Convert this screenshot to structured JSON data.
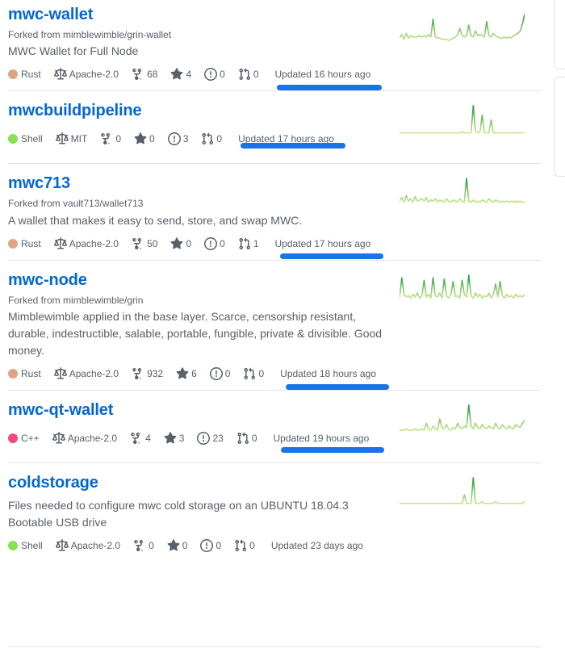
{
  "colors": {
    "link_blue": "#0366d6",
    "muted_text": "#586069",
    "border": "#e1e4e8",
    "highlight_blue": "#1a73e8",
    "spark_light": "#c6e48b",
    "spark_dark": "#239a3b"
  },
  "icons": {
    "law": "law-icon",
    "fork": "repo-forked-icon",
    "star": "star-icon",
    "issue": "issue-opened-icon",
    "pull": "git-pull-request-icon",
    "lang_dot": "language-color-dot-icon"
  },
  "languages": {
    "Rust": "#dea584",
    "Shell": "#89e051",
    "C++": "#f34b7d"
  },
  "repos": [
    {
      "name": "mwc-wallet",
      "forked_from": "Forked from mimblewimble/grin-wallet",
      "description": "MWC Wallet for Full Node",
      "language": "Rust",
      "license": "Apache-2.0",
      "forks": "68",
      "stars": "4",
      "issues": "0",
      "pulls": "0",
      "updated": "Updated 16 hours ago",
      "highlighted": true,
      "sparkline": [
        6,
        9,
        5,
        10,
        6,
        8,
        7,
        7,
        7,
        8,
        7,
        8,
        7,
        9,
        7,
        22,
        7,
        6,
        6,
        5,
        5,
        5,
        4,
        5,
        6,
        7,
        9,
        14,
        8,
        7,
        8,
        17,
        8,
        7,
        12,
        8,
        9,
        8,
        7,
        20,
        8,
        7,
        10,
        8,
        7,
        6,
        6,
        7,
        6,
        7,
        6,
        8,
        9,
        10,
        12,
        18,
        26
      ]
    },
    {
      "name": "mwcbuildpipeline",
      "forked_from": "",
      "description": "",
      "language": "Shell",
      "license": "MIT",
      "forks": "0",
      "stars": "0",
      "issues": "3",
      "pulls": "0",
      "updated": "Updated 17 hours ago",
      "highlighted": true,
      "sparkline": [
        3,
        3,
        3,
        3,
        3,
        3,
        3,
        3,
        3,
        3,
        3,
        3,
        3,
        3,
        3,
        3,
        3,
        3,
        3,
        3,
        3,
        3,
        3,
        3,
        3,
        3,
        3,
        3,
        4,
        3,
        3,
        3,
        3,
        26,
        4,
        3,
        4,
        18,
        3,
        3,
        3,
        14,
        3,
        3,
        3,
        3,
        3,
        3,
        3,
        3,
        3,
        3,
        3,
        3,
        3,
        3,
        3
      ]
    },
    {
      "name": "mwc713",
      "forked_from": "Forked from vault713/wallet713",
      "description": "A wallet that makes it easy to send, store, and swap MWC.",
      "language": "Rust",
      "license": "Apache-2.0",
      "forks": "50",
      "stars": "0",
      "issues": "0",
      "pulls": "1",
      "updated": "Updated 17 hours ago",
      "highlighted": true,
      "sparkline": [
        7,
        10,
        6,
        12,
        7,
        9,
        6,
        11,
        7,
        8,
        9,
        7,
        10,
        6,
        8,
        7,
        9,
        6,
        8,
        7,
        6,
        9,
        7,
        6,
        8,
        7,
        6,
        9,
        7,
        6,
        27,
        7,
        6,
        8,
        6,
        7,
        6,
        8,
        7,
        6,
        9,
        7,
        6,
        8,
        7,
        6,
        7,
        6,
        7,
        6,
        7,
        6,
        7,
        6,
        7,
        6,
        6
      ]
    },
    {
      "name": "mwc-node",
      "forked_from": "Forked from mimblewimble/grin",
      "description": "Mimblewimble applied in the base layer. Scarce, censorship resistant, durable, indestructible, salable, portable, fungible, private & divisible. Good money.",
      "language": "Rust",
      "license": "Apache-2.0",
      "forks": "932",
      "stars": "6",
      "issues": "0",
      "pulls": "0",
      "updated": "Updated 18 hours ago",
      "highlighted": true,
      "sparkline": [
        6,
        22,
        9,
        7,
        8,
        6,
        9,
        7,
        10,
        6,
        8,
        20,
        7,
        9,
        6,
        22,
        8,
        7,
        10,
        6,
        21,
        8,
        6,
        9,
        19,
        7,
        8,
        6,
        20,
        9,
        7,
        24,
        8,
        6,
        10,
        7,
        9,
        6,
        8,
        7,
        10,
        6,
        9,
        17,
        7,
        19,
        8,
        6,
        9,
        7,
        8,
        6,
        9,
        7,
        8,
        7,
        9
      ]
    },
    {
      "name": "mwc-qt-wallet",
      "forked_from": "",
      "description": "",
      "language": "C++",
      "license": "Apache-2.0",
      "forks": "4",
      "stars": "3",
      "issues": "23",
      "pulls": "0",
      "updated": "Updated 19 hours ago",
      "highlighted": true,
      "sparkline": [
        4,
        4,
        4,
        5,
        4,
        4,
        4,
        5,
        4,
        4,
        5,
        4,
        9,
        5,
        4,
        7,
        5,
        4,
        12,
        6,
        5,
        8,
        5,
        4,
        6,
        5,
        9,
        6,
        5,
        7,
        6,
        22,
        7,
        5,
        9,
        6,
        5,
        8,
        6,
        5,
        7,
        6,
        5,
        9,
        6,
        5,
        8,
        6,
        5,
        7,
        6,
        5,
        8,
        7,
        6,
        9,
        11
      ]
    },
    {
      "name": "coldstorage",
      "forked_from": "",
      "description": "Files needed to configure mwc cold storage on an UBUNTU 18.04.3 Bootable USB drive",
      "language": "Shell",
      "license": "Apache-2.0",
      "forks": "0",
      "stars": "0",
      "issues": "0",
      "pulls": "0",
      "updated": "Updated 23 days ago",
      "highlighted": false,
      "sparkline": [
        3,
        3,
        3,
        3,
        3,
        3,
        3,
        3,
        3,
        3,
        3,
        3,
        3,
        3,
        3,
        3,
        3,
        3,
        3,
        3,
        3,
        3,
        3,
        3,
        3,
        3,
        3,
        3,
        3,
        8,
        3,
        3,
        3,
        18,
        3,
        3,
        3,
        4,
        3,
        3,
        3,
        3,
        3,
        4,
        3,
        3,
        3,
        3,
        3,
        3,
        3,
        3,
        3,
        3,
        3,
        3,
        4
      ]
    }
  ]
}
